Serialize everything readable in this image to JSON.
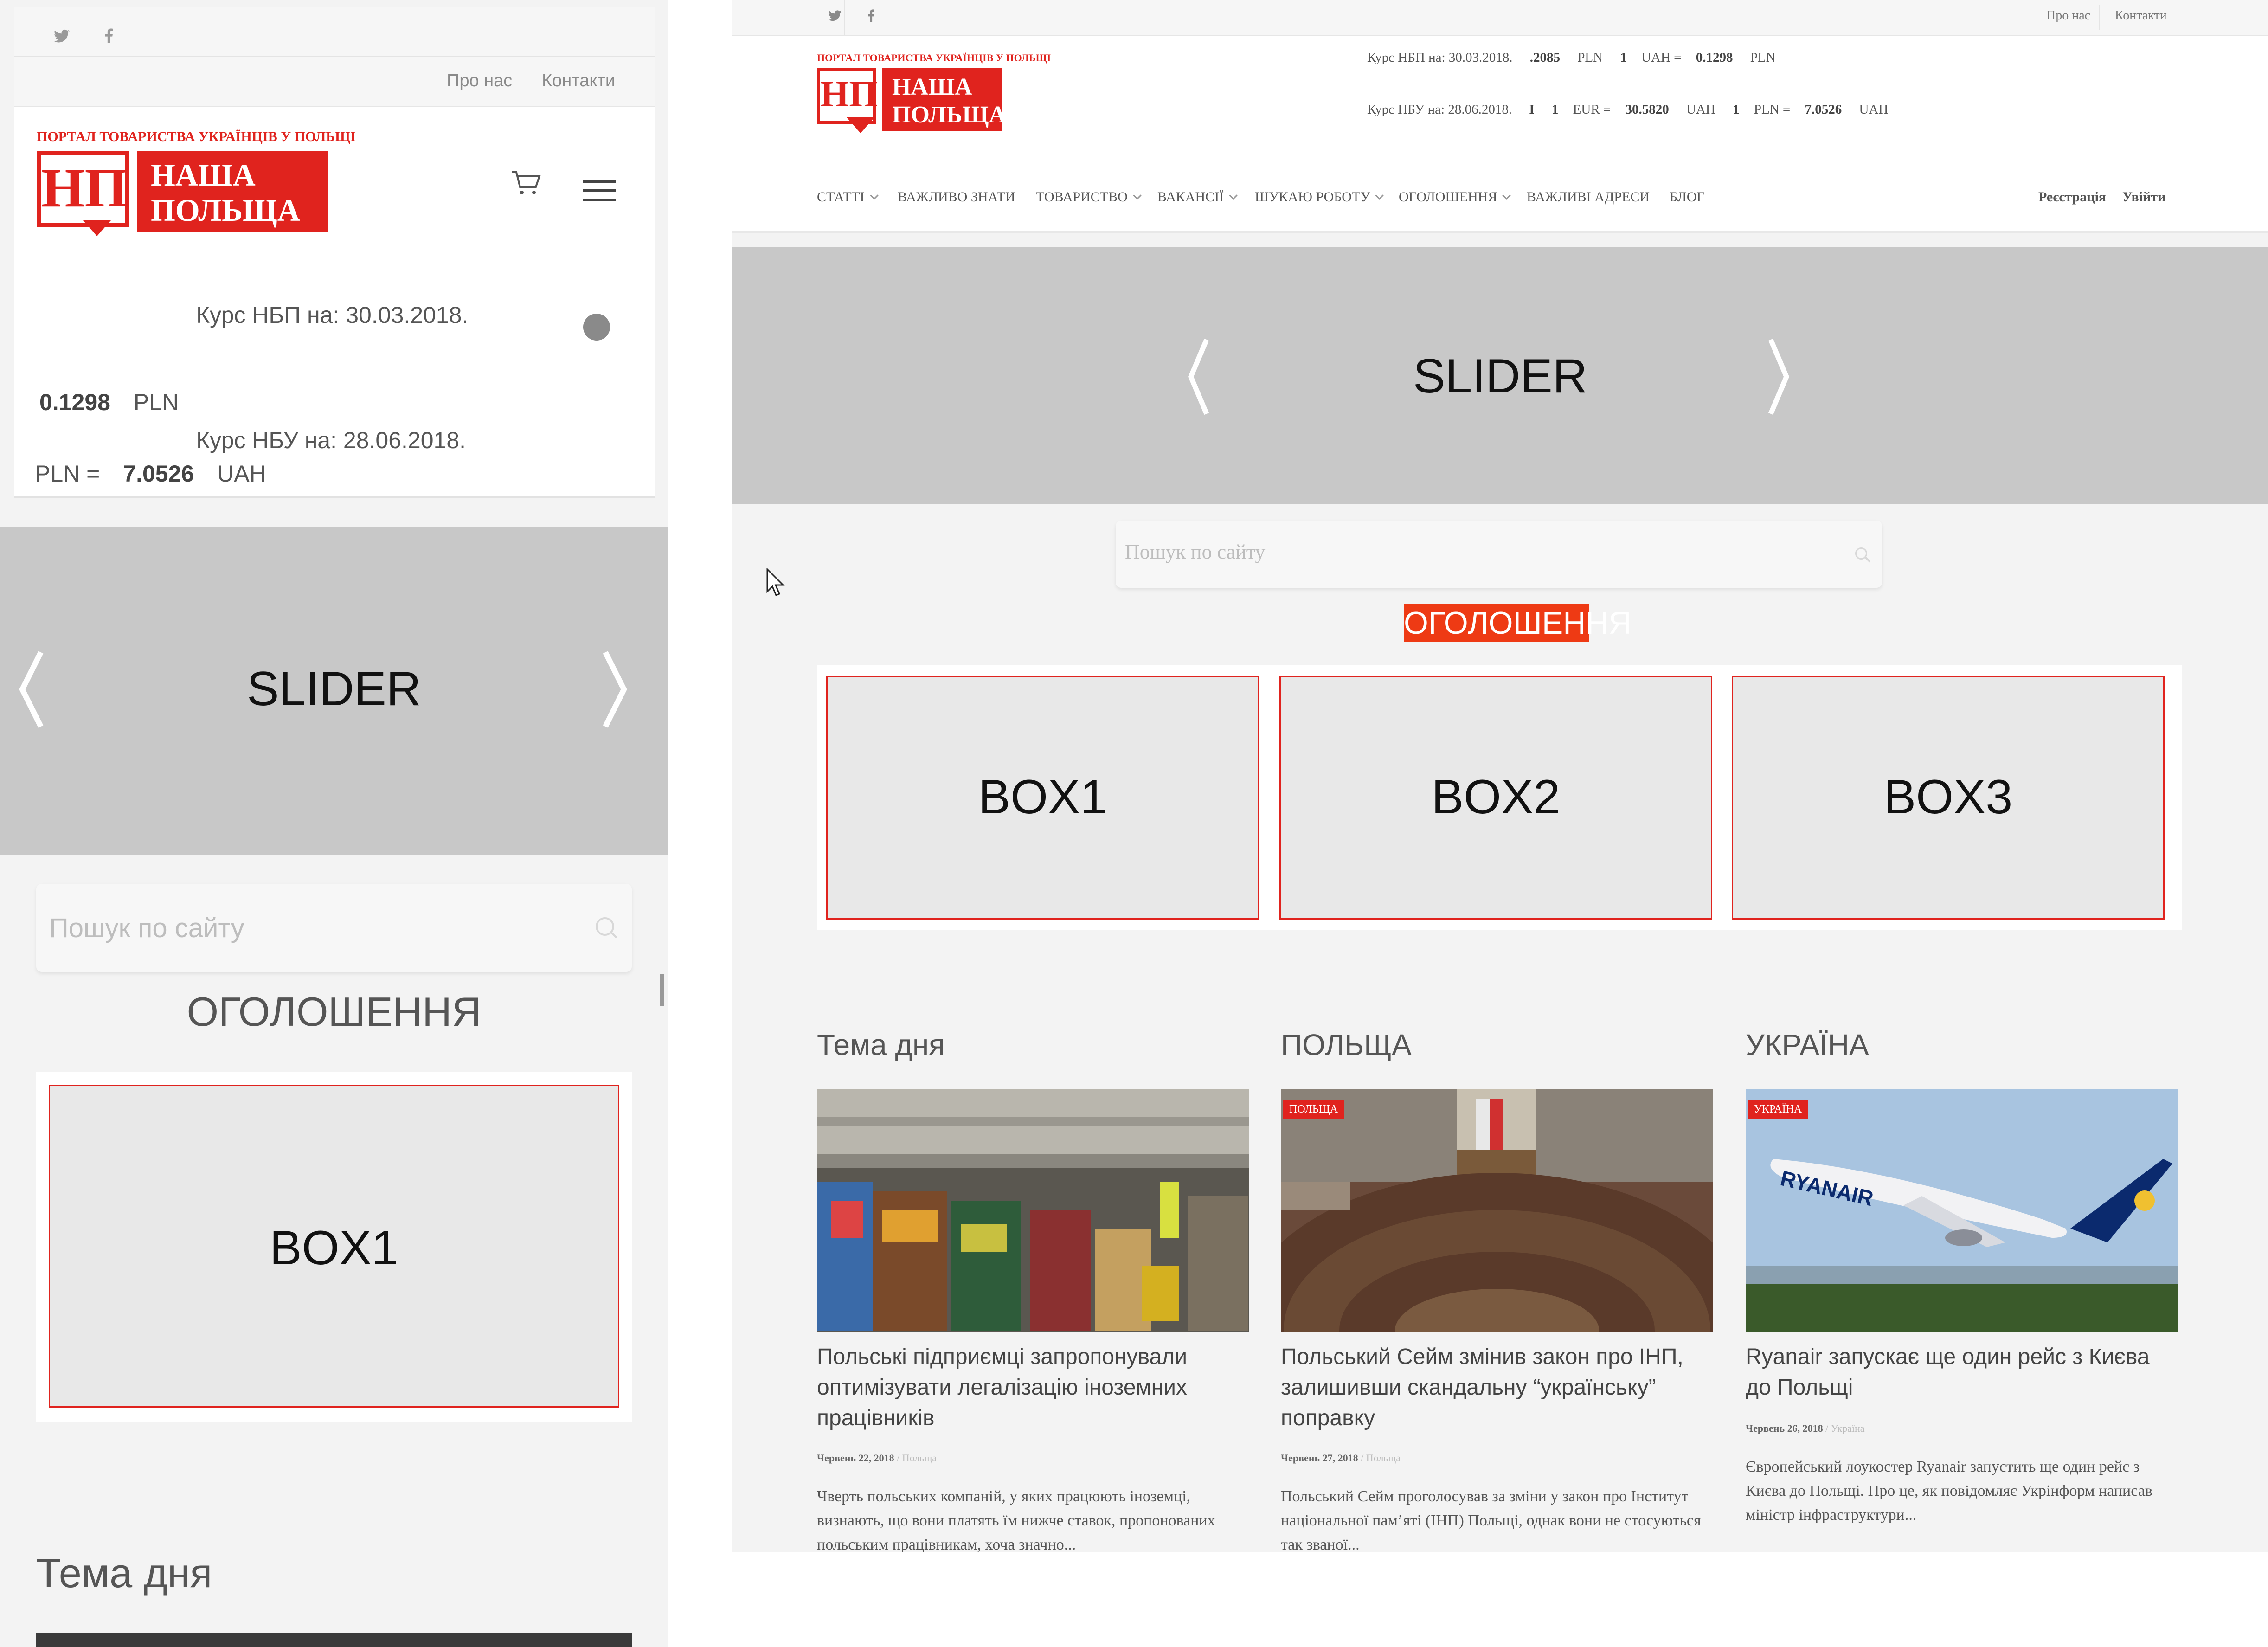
{
  "mobile": {
    "social": {
      "twitter_icon": "twitter-icon",
      "facebook_icon": "facebook-icon"
    },
    "top_links": {
      "about": "Про нас",
      "contacts": "Контакти"
    },
    "logo": {
      "tagline": "ПОРТАЛ ТОВАРИСТВА УКРАЇНЦІВ У ПОЛЬЩІ",
      "abbr": "НП",
      "name_line1": "НАША",
      "name_line2": "ПОЛЬЩА"
    },
    "nbp_label": "Курс НБП на: 30.03.2018.",
    "nbp_value": "0.1298",
    "nbp_currency": "PLN",
    "nbu_label": "Курс НБУ на: 28.06.2018.",
    "nbu_prefix": "PLN =",
    "nbu_value": "7.0526",
    "nbu_currency": "UAH",
    "slider_label": "SLIDER",
    "search_placeholder": "Пошук по сайту",
    "announcements_title": "ОГОЛОШЕННЯ",
    "box1": "BOX1",
    "topic_title": "Тема дня"
  },
  "desktop": {
    "top_links": {
      "about": "Про нас",
      "contacts": "Контакти"
    },
    "logo": {
      "tagline": "ПОРТАЛ ТОВАРИСТВА УКРАЇНЦІВ У ПОЛЬЩІ",
      "abbr": "НП",
      "name_line1": "НАША",
      "name_line2": "ПОЛЬЩА"
    },
    "rates": {
      "nbp_label": "Курс НБП на: 30.03.2018.",
      "nbp_a": ".2085",
      "nbp_a_cur": "PLN",
      "nbp_one": "1",
      "nbp_b_cur": "UAH =",
      "nbp_b": "0.1298",
      "nbp_b_cur2": "PLN",
      "nbu_label": "Курс НБУ на: 28.06.2018.",
      "nbu_i": "I",
      "nbu_one": "1",
      "nbu_eur": "EUR =",
      "nbu_eur_val": "30.5820",
      "nbu_uah": "UAH",
      "nbu_one2": "1",
      "nbu_pln": "PLN =",
      "nbu_pln_val": "7.0526",
      "nbu_uah2": "UAH"
    },
    "nav": [
      "СТАТТІ",
      "ВАЖЛИВО ЗНАТИ",
      "ТОВАРИСТВО",
      "ВАКАНСІЇ",
      "ШУКАЮ РОБОТУ",
      "ОГОЛОШЕННЯ",
      "ВАЖЛИВІ АДРЕСИ",
      "БЛОГ"
    ],
    "register": "Реєстрація",
    "login": "Увійти",
    "slider_label": "SLIDER",
    "search_placeholder": "Пошук по сайту",
    "announcements_title": "ОГОЛОШЕННЯ",
    "boxes": [
      "BOX1",
      "BOX2",
      "BOX3"
    ],
    "news": [
      {
        "section": "Тема дня",
        "badge": "",
        "title": "Польські підприємці запропонували оптимізувати легалізацію іноземних працівників",
        "date": "Червень 22, 2018",
        "category": "Польща",
        "excerpt": "Чверть польських компаній, у яких працюють іноземці, визнають, що вони платять їм нижче ставок, пропонованих польським працівникам, хоча значно..."
      },
      {
        "section": "ПОЛЬЩА",
        "badge": "ПОЛЬЩА",
        "title": "Польський Сейм змінив закон про ІНП, залишивши скандальну “українську” поправку",
        "date": "Червень 27, 2018",
        "category": "Польща",
        "excerpt": "Польський Сейм проголосував за зміни у закон про Інститут національної пам’яті (ІНП) Польщі, однак вони не стосуються так званої..."
      },
      {
        "section": "УКРАЇНА",
        "badge": "УКРАЇНА",
        "title": "Ryanair запускає ще один рейс з Києва до Польщі",
        "date": "Червень 26, 2018",
        "category": "Україна",
        "excerpt": "Європейський лоукостер Ryanair запустить ще один рейс з Києва до Польщі. Про це, як повідомляє Укрінформ написав міністр інфраструктури..."
      }
    ],
    "plane_text": "RYANAIR"
  }
}
